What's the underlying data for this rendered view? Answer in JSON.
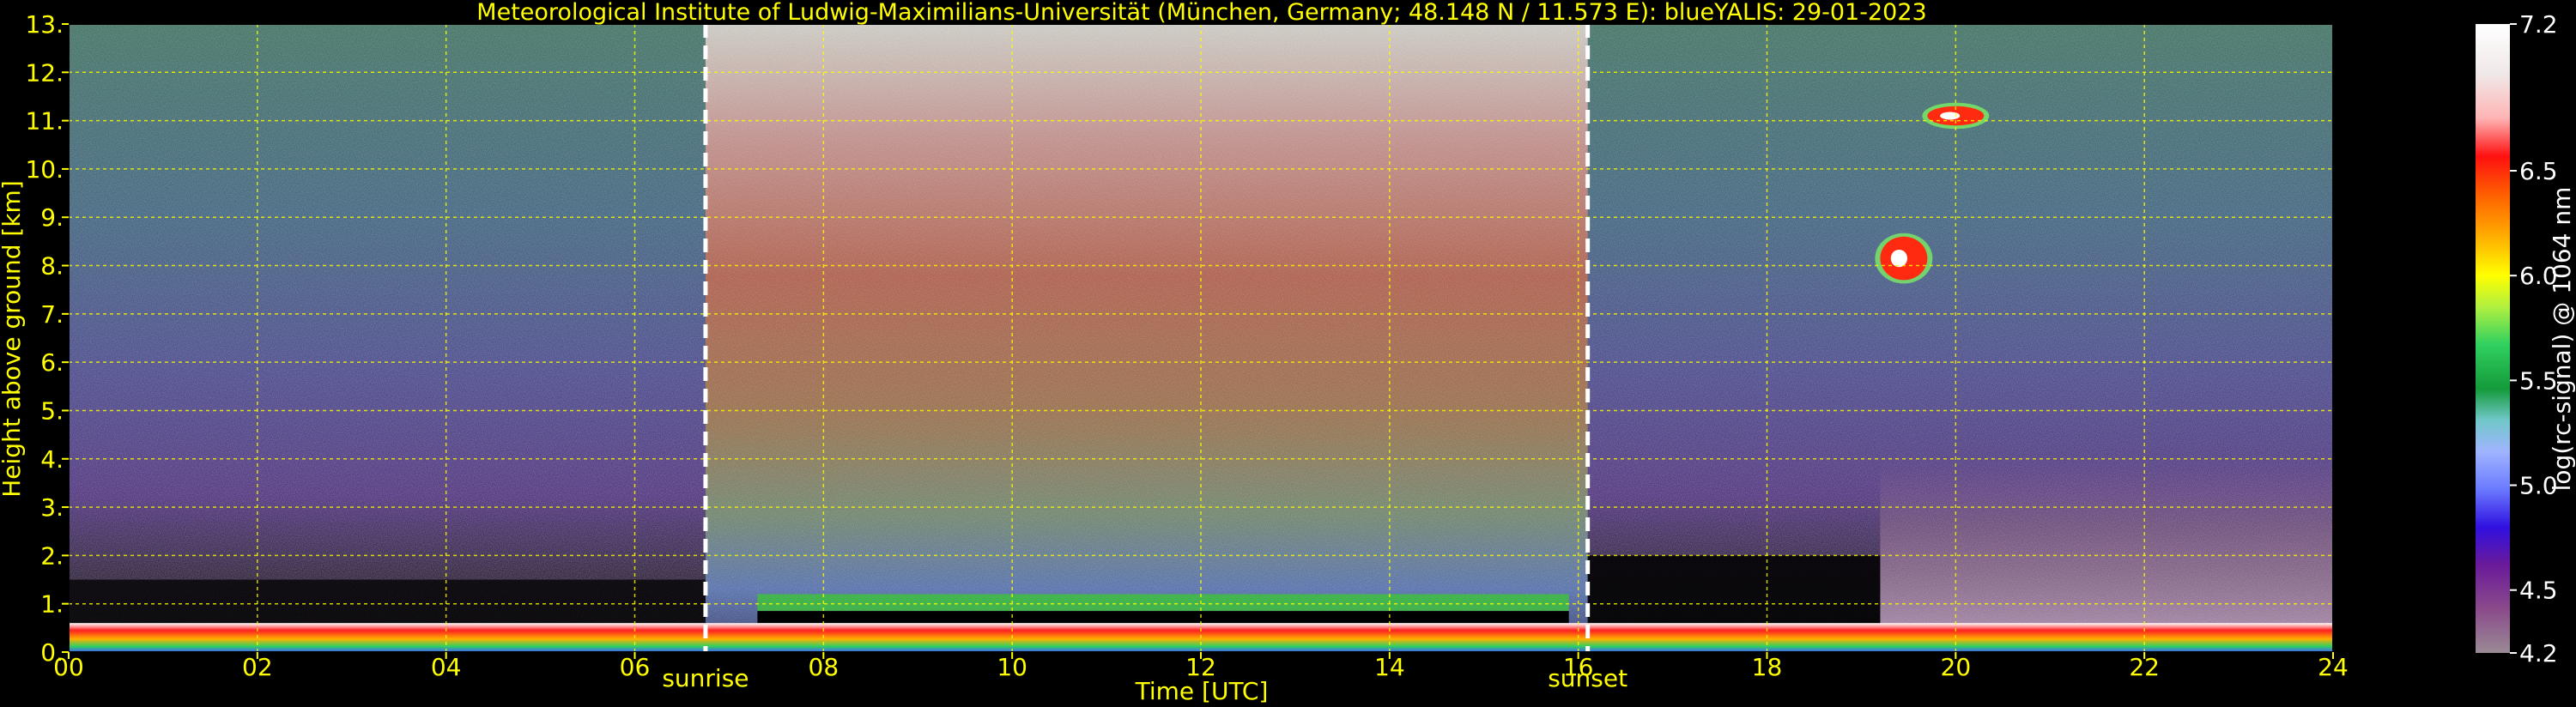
{
  "chart_data": {
    "type": "heatmap",
    "title": "Meteorological Institute of Ludwig-Maximilians-Universität (München, Germany; 48.148 N / 11.573 E):    blueYALIS: 29-01-2023",
    "xlabel": "Time [UTC]",
    "ylabel": "Height above ground [km]",
    "xlim": [
      0,
      24
    ],
    "ylim": [
      0,
      13
    ],
    "x_ticks": [
      "00",
      "02",
      "04",
      "06",
      "08",
      "10",
      "12",
      "14",
      "16",
      "18",
      "20",
      "22",
      "24"
    ],
    "y_ticks": [
      "0.",
      "1.",
      "2.",
      "3.",
      "4.",
      "5.",
      "6.",
      "7.",
      "8.",
      "9.",
      "10.",
      "11.",
      "12.",
      "13."
    ],
    "grid": true,
    "markers": [
      {
        "label": "sunrise",
        "x": 6.75
      },
      {
        "label": "sunset",
        "x": 16.1
      }
    ],
    "colorbar": {
      "label": "log(rc-signal) @ 1064 nm",
      "range": [
        4.2,
        7.2
      ],
      "ticks": [
        "7.2",
        "6.5",
        "6.0",
        "5.5",
        "5.0",
        "4.5",
        "4.2"
      ]
    },
    "features": [
      {
        "name": "boundary layer aerosol",
        "x": [
          0,
          24
        ],
        "height": [
          0,
          0.6
        ]
      },
      {
        "name": "cloud",
        "x": [
          19.2,
          19.7
        ],
        "height": [
          7.7,
          8.6
        ]
      },
      {
        "name": "cloud",
        "x": [
          19.7,
          20.3
        ],
        "height": [
          10.9,
          11.3
        ]
      }
    ]
  }
}
